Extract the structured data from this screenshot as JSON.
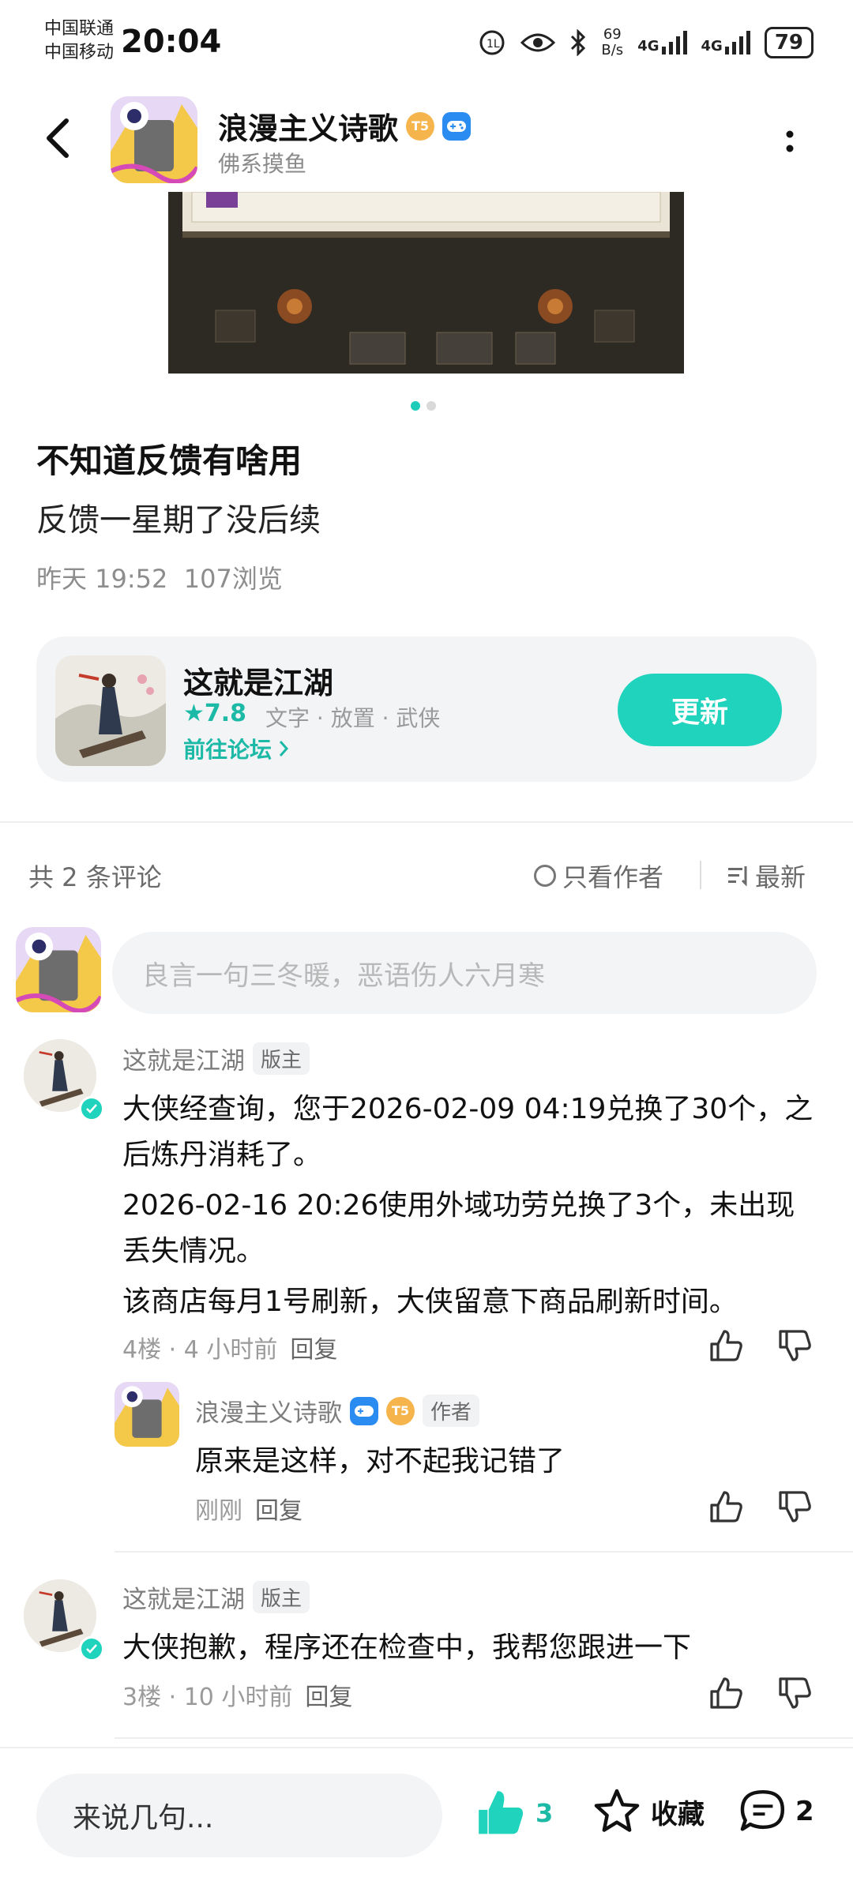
{
  "status_bar": {
    "carrier1": "中国联通",
    "carrier2": "中国移动",
    "time": "20:04",
    "net_speed_value": "69",
    "net_speed_unit": "B/s",
    "signal1": "4G",
    "signal2": "4G",
    "battery": "79"
  },
  "header": {
    "name": "浪漫主义诗歌",
    "subtitle": "佛系摸鱼",
    "level_badge": "5"
  },
  "post": {
    "carousel_index": 0,
    "carousel_total": 2,
    "title": "不知道反馈有啥用",
    "body": "反馈一星期了没后续",
    "meta": "昨天 19:52  107浏览"
  },
  "game_card": {
    "name": "这就是江湖",
    "rating": "★7.8",
    "tags": "文字 · 放置 · 武侠",
    "forum_link": "前往论坛",
    "update_button": "更新"
  },
  "comments_header": {
    "count": "共 2 条评论",
    "author_only": "只看作者",
    "sort": "最新"
  },
  "comment_input": {
    "placeholder": "良言一句三冬暖，恶语伤人六月寒"
  },
  "comments": [
    {
      "author": "这就是江湖",
      "role": "版主",
      "paragraphs": [
        "大侠经查询，您于2026-02-09 04:19兑换了30个，之后炼丹消耗了。",
        "2026-02-16 20:26使用外域功劳兑换了3个，未出现丢失情况。",
        "该商店每月1号刷新，大侠留意下商品刷新时间。"
      ],
      "meta": "4楼 · 4 小时前",
      "reply_label": "回复",
      "replies": [
        {
          "author": "浪漫主义诗歌",
          "role": "作者",
          "level_badge": "5",
          "text": "原来是这样，对不起我记错了",
          "meta": "刚刚",
          "reply_label": "回复"
        }
      ]
    },
    {
      "author": "这就是江湖",
      "role": "版主",
      "paragraphs": [
        "大侠抱歉，程序还在检查中，我帮您跟进一下"
      ],
      "meta": "3楼 · 10 小时前",
      "reply_label": "回复"
    }
  ],
  "bottom_bar": {
    "input_placeholder": "来说几句...",
    "like_count": "3",
    "favorite_label": "收藏",
    "comment_count": "2"
  },
  "colors": {
    "accent": "#1fd3bd",
    "accent_text": "#1bb9a6",
    "card_bg": "#f2f4f6",
    "muted_text": "#8d8d8d"
  },
  "icons": [
    "back-arrow-icon",
    "more-vertical-icon",
    "thumb-up-icon",
    "thumb-down-icon",
    "star-icon",
    "comment-bubble-icon",
    "sort-icon",
    "chevron-right-icon",
    "verified-check-icon",
    "game-controller-icon"
  ]
}
